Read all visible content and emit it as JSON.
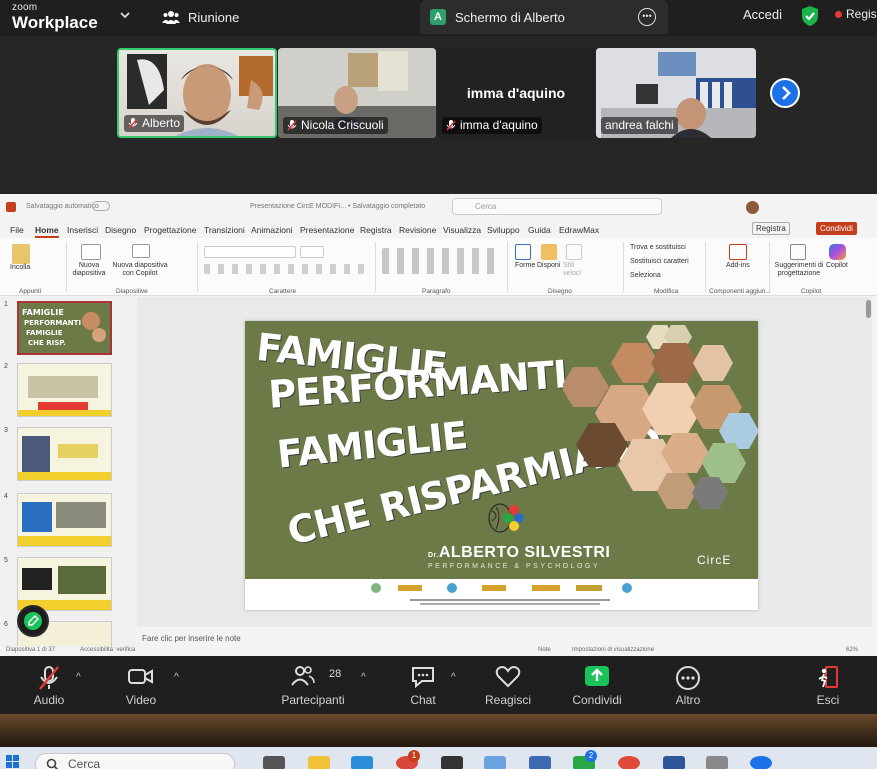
{
  "zoom": {
    "logo_small": "zoom",
    "logo_big": "Workplace",
    "meeting_tab": "Riunione",
    "share_tab": "Schermo di Alberto",
    "share_badge": "A",
    "login": "Accedi",
    "record": "Regis"
  },
  "participants": [
    {
      "name": "Alberto"
    },
    {
      "name": "Nicola Criscuoli"
    },
    {
      "name": "imma d'aquino",
      "big_name": "imma d'aquino"
    },
    {
      "name": "andrea falchi"
    }
  ],
  "powerpoint": {
    "title_autosave": "Salvataggio automatico",
    "title_file": "Presentazione CircE MODIFI... • Salvataggio completato",
    "search_placeholder": "Cerca",
    "tabs": [
      "File",
      "Home",
      "Inserisci",
      "Disegno",
      "Progettazione",
      "Transizioni",
      "Animazioni",
      "Presentazione",
      "Registra",
      "Revisione",
      "Visualizza",
      "Sviluppo",
      "Guida",
      "EdrawMax"
    ],
    "btn_registra": "Registra",
    "btn_condividi": "Condividi",
    "ribbon": {
      "paste": "Incolla",
      "new_slide": "Nuova diapositiva",
      "new_slide_copilot": "Nuova diapositiva con Copilot",
      "shapes": "Forme",
      "arrange": "Disponi",
      "quick_styles": "Stili veloci",
      "find_replace": "Trova e sostituisci",
      "replace_chars": "Sostituisci caratteri",
      "select": "Seleziona",
      "addins": "Add-ins",
      "design_suggestions": "Suggerimenti di progettazione",
      "copilot": "Copilot",
      "groups": [
        "Appunti",
        "Diapositive",
        "Carattere",
        "Paragrafo",
        "Disegno",
        "Modifica",
        "Componenti aggiun...",
        "Copilot"
      ]
    },
    "thumb_numbers": [
      "1",
      "2",
      "3",
      "4",
      "5",
      "6"
    ],
    "slide": {
      "line1": "FAMIGLIE",
      "line2": "PERFORMANTI",
      "line3": "FAMIGLIE",
      "line4": "CHE RISPARMIANO",
      "presenter_prefix": "Dr.",
      "presenter": "ALBERTO SILVESTRI",
      "presenter_sub": "PERFORMANCE & PSYCHOLOGY",
      "brand": "CircE"
    },
    "notes_hint": "Fare clic per inserire le note",
    "status_left": "Diapositiva 1 di 37",
    "status_accessibility": "Accessibilità: verifica",
    "status_notes": "Note",
    "status_display": "Impostazioni di visualizzazione",
    "status_zoom": "62%"
  },
  "toolbar": {
    "audio": "Audio",
    "video": "Video",
    "participants": "Partecipanti",
    "participants_count": "28",
    "chat": "Chat",
    "react": "Reagisci",
    "share": "Condividi",
    "more": "Altro",
    "leave": "Esci"
  },
  "taskbar": {
    "search_placeholder": "Cerca",
    "chrome_badge": "1",
    "app_badge": "2"
  },
  "colors": {
    "zoom_green": "#37c96e",
    "zoom_blue": "#1d71e8",
    "slide_green": "#6b7a47",
    "ppt_red": "#c43e1c",
    "share_green": "#19c35a",
    "leave_red": "#e53935"
  }
}
